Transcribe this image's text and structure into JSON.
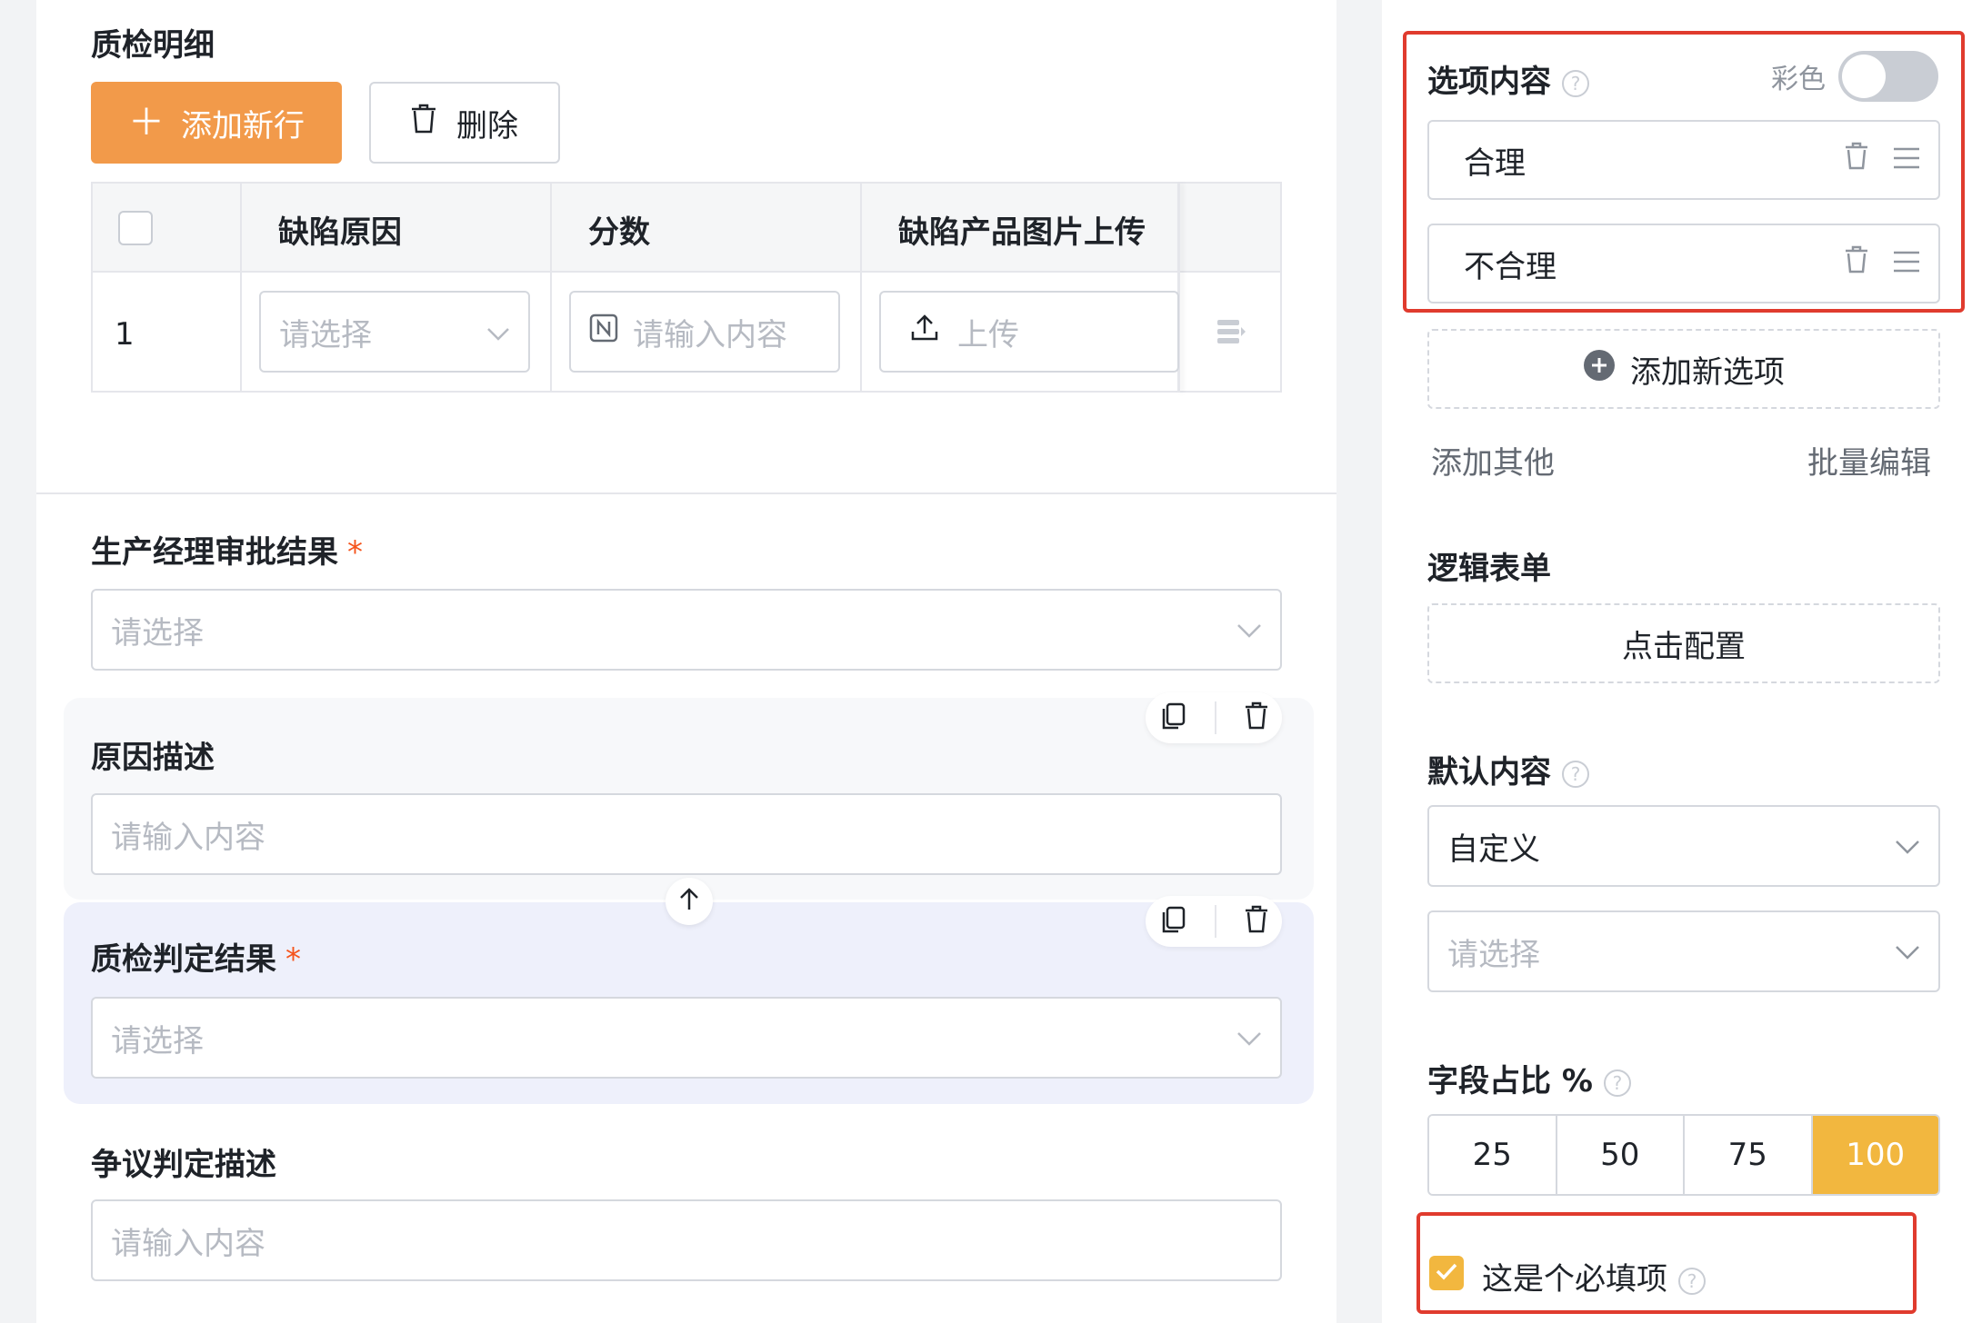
{
  "left": {
    "section_title": "质检明细",
    "add_row_label": "添加新行",
    "delete_label": "删除",
    "table": {
      "headers": [
        "缺陷原因",
        "分数",
        "缺陷产品图片上传"
      ],
      "row_index": "1",
      "select_placeholder": "请选择",
      "number_placeholder": "请输入内容",
      "upload_label": "上传"
    },
    "fields": [
      {
        "label": "生产经理审批结果",
        "required": true,
        "placeholder": "请选择"
      },
      {
        "label": "原因描述",
        "required": false,
        "placeholder": "请输入内容"
      },
      {
        "label": "质检判定结果",
        "required": true,
        "placeholder": "请选择"
      },
      {
        "label": "争议判定描述",
        "required": false,
        "placeholder": "请输入内容"
      }
    ],
    "required_mark": "*"
  },
  "right": {
    "options_title": "选项内容",
    "color_label": "彩色",
    "color_enabled": false,
    "options": [
      "合理",
      "不合理"
    ],
    "add_option_label": "添加新选项",
    "add_other_label": "添加其他",
    "batch_edit_label": "批量编辑",
    "logic_title": "逻辑表单",
    "logic_button": "点击配置",
    "default_title": "默认内容",
    "default_type": "自定义",
    "default_placeholder": "请选择",
    "width_title": "字段占比 %",
    "width_options": [
      "25",
      "50",
      "75",
      "100"
    ],
    "width_selected": "100",
    "required_label": "这是个必填项",
    "required_checked": true
  },
  "colors": {
    "primary": "#f29a4a",
    "accent": "#f2b73f",
    "highlight_border": "#e03b2e",
    "required_star": "#f5541c"
  }
}
